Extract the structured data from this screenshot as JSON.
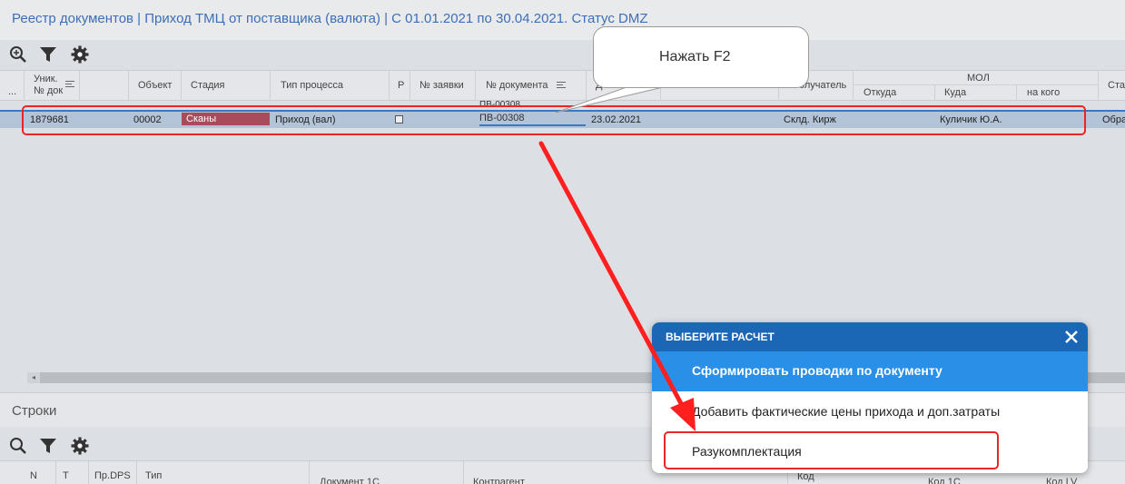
{
  "window": {
    "title": "Реестр документов | Приход ТМЦ от поставщика (валюта) | С 01.01.2021 по 30.04.2021. Статус DMZ"
  },
  "toolbar": {
    "icons": [
      "zoom-search-icon",
      "filter-icon",
      "gear-icon"
    ]
  },
  "grid": {
    "headers": {
      "dots": "...",
      "uniq_line1": "Уник.",
      "uniq_line2": "№ док",
      "object": "Объект",
      "stage": "Стадия",
      "process_type": "Тип процесса",
      "r": "Р",
      "request_no": "№ заявки",
      "doc_no": "№ документа",
      "d": "Д",
      "receiver": "олучатель",
      "mol": "МОЛ",
      "from": "Откуда",
      "to": "Куда",
      "to_whom": "на кого",
      "sta": "Ста"
    },
    "row": {
      "uniq": "1879681",
      "object": "00002",
      "stage": "Сканы",
      "process_type": "Приход (вал)",
      "doc_no": "ПВ-00308",
      "doc_no_ghost": "ПВ-00308",
      "date": "23.02.2021",
      "receiver": "Склд. Кирж",
      "to": "Куличик Ю.А.",
      "sta": "Обра"
    }
  },
  "callout": {
    "text": "Нажать F2"
  },
  "lines_section": {
    "title": "Строки",
    "headers": {
      "n": "N",
      "t": "Т",
      "pr_dps": "Пр.DPS",
      "type": "Тип",
      "doc1c": "Документ 1С",
      "contractor": "Контрагент",
      "code": "Код",
      "code1c": "Код 1С",
      "code_lv": "Код LV"
    }
  },
  "dialog": {
    "title": "ВЫБЕРИТЕ РАСЧЕТ",
    "options": [
      "Сформировать проводки по документу",
      "Добавить фактические цены прихода и доп.затраты",
      "Разукомплектация"
    ]
  },
  "colors": {
    "title_blue": "#3d6fb6",
    "stage_badge": "#a84b5b",
    "dialog_header": "#1b66b5",
    "dialog_selected": "#2a8fe6",
    "annotation_red": "#e8262a"
  }
}
